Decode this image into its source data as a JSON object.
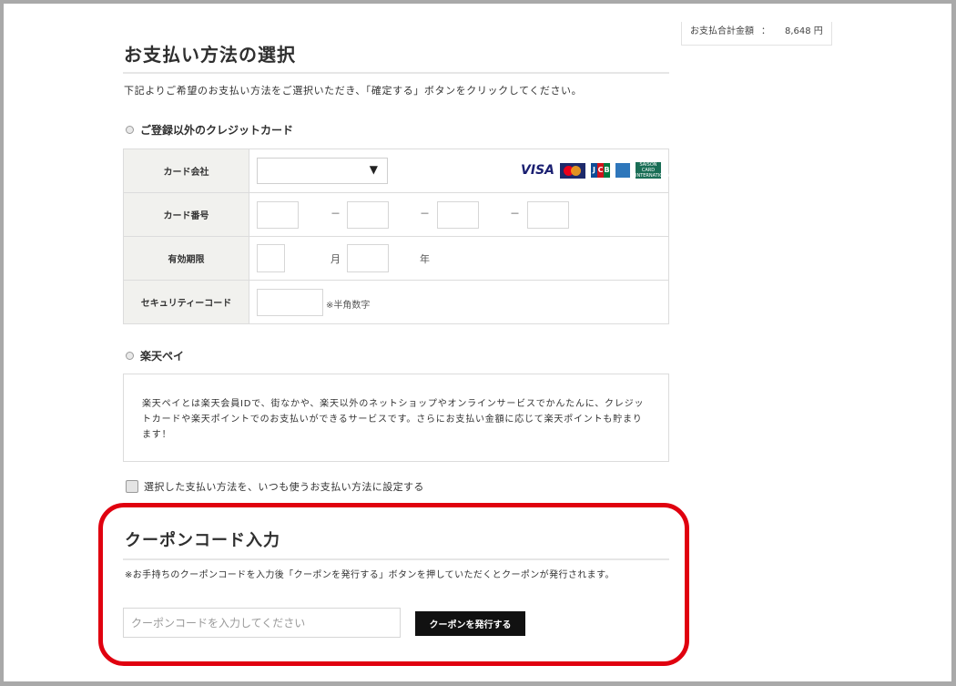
{
  "summary": {
    "label": "お支払合計金額",
    "colon": "：",
    "amount": "8,648 円"
  },
  "payment": {
    "title": "お支払い方法の選択",
    "intro": "下記よりご希望のお支払い方法をご選択いただき、「確定する」ボタンをクリックしてください。",
    "credit_option": "ご登録以外のクレジットカード",
    "card_fields": {
      "company_label": "カード会社",
      "company_value": "",
      "number_label": "カード番号",
      "number_sep": "－",
      "expiry_label": "有効期限",
      "month_unit": "月",
      "year_unit": "年",
      "security_label": "セキュリティーコード",
      "security_note": "※半角数字"
    },
    "brands": {
      "visa": "VISA",
      "jcb": [
        "J",
        "C",
        "B"
      ],
      "saison": [
        "SAISON",
        "CARD",
        "INTERNATIONAL"
      ],
      "icons": [
        "visa-logo-icon",
        "mastercard-logo-icon",
        "jcb-logo-icon",
        "amex-logo-icon",
        "saison-card-logo-icon"
      ]
    },
    "rakuten_option": "楽天ペイ",
    "rakuten_desc": "楽天ペイとは楽天会員IDで、街なかや、楽天以外のネットショップやオンラインサービスでかんたんに、クレジットカードや楽天ポイントでのお支払いができるサービスです。さらにお支払い金額に応じて楽天ポイントも貯まります！",
    "default_label": "選択した支払い方法を、いつも使うお支払い方法に設定する"
  },
  "coupon": {
    "title": "クーポンコード入力",
    "desc": "※お手持ちのクーポンコードを入力後「クーポンを発行する」ボタンを押していただくとクーポンが発行されます。",
    "placeholder": "クーポンコードを入力してください",
    "button": "クーポンを発行する"
  },
  "colors": {
    "highlight": "#e0000f",
    "button_bg": "#111111",
    "label_bg": "#f1f1ee"
  }
}
